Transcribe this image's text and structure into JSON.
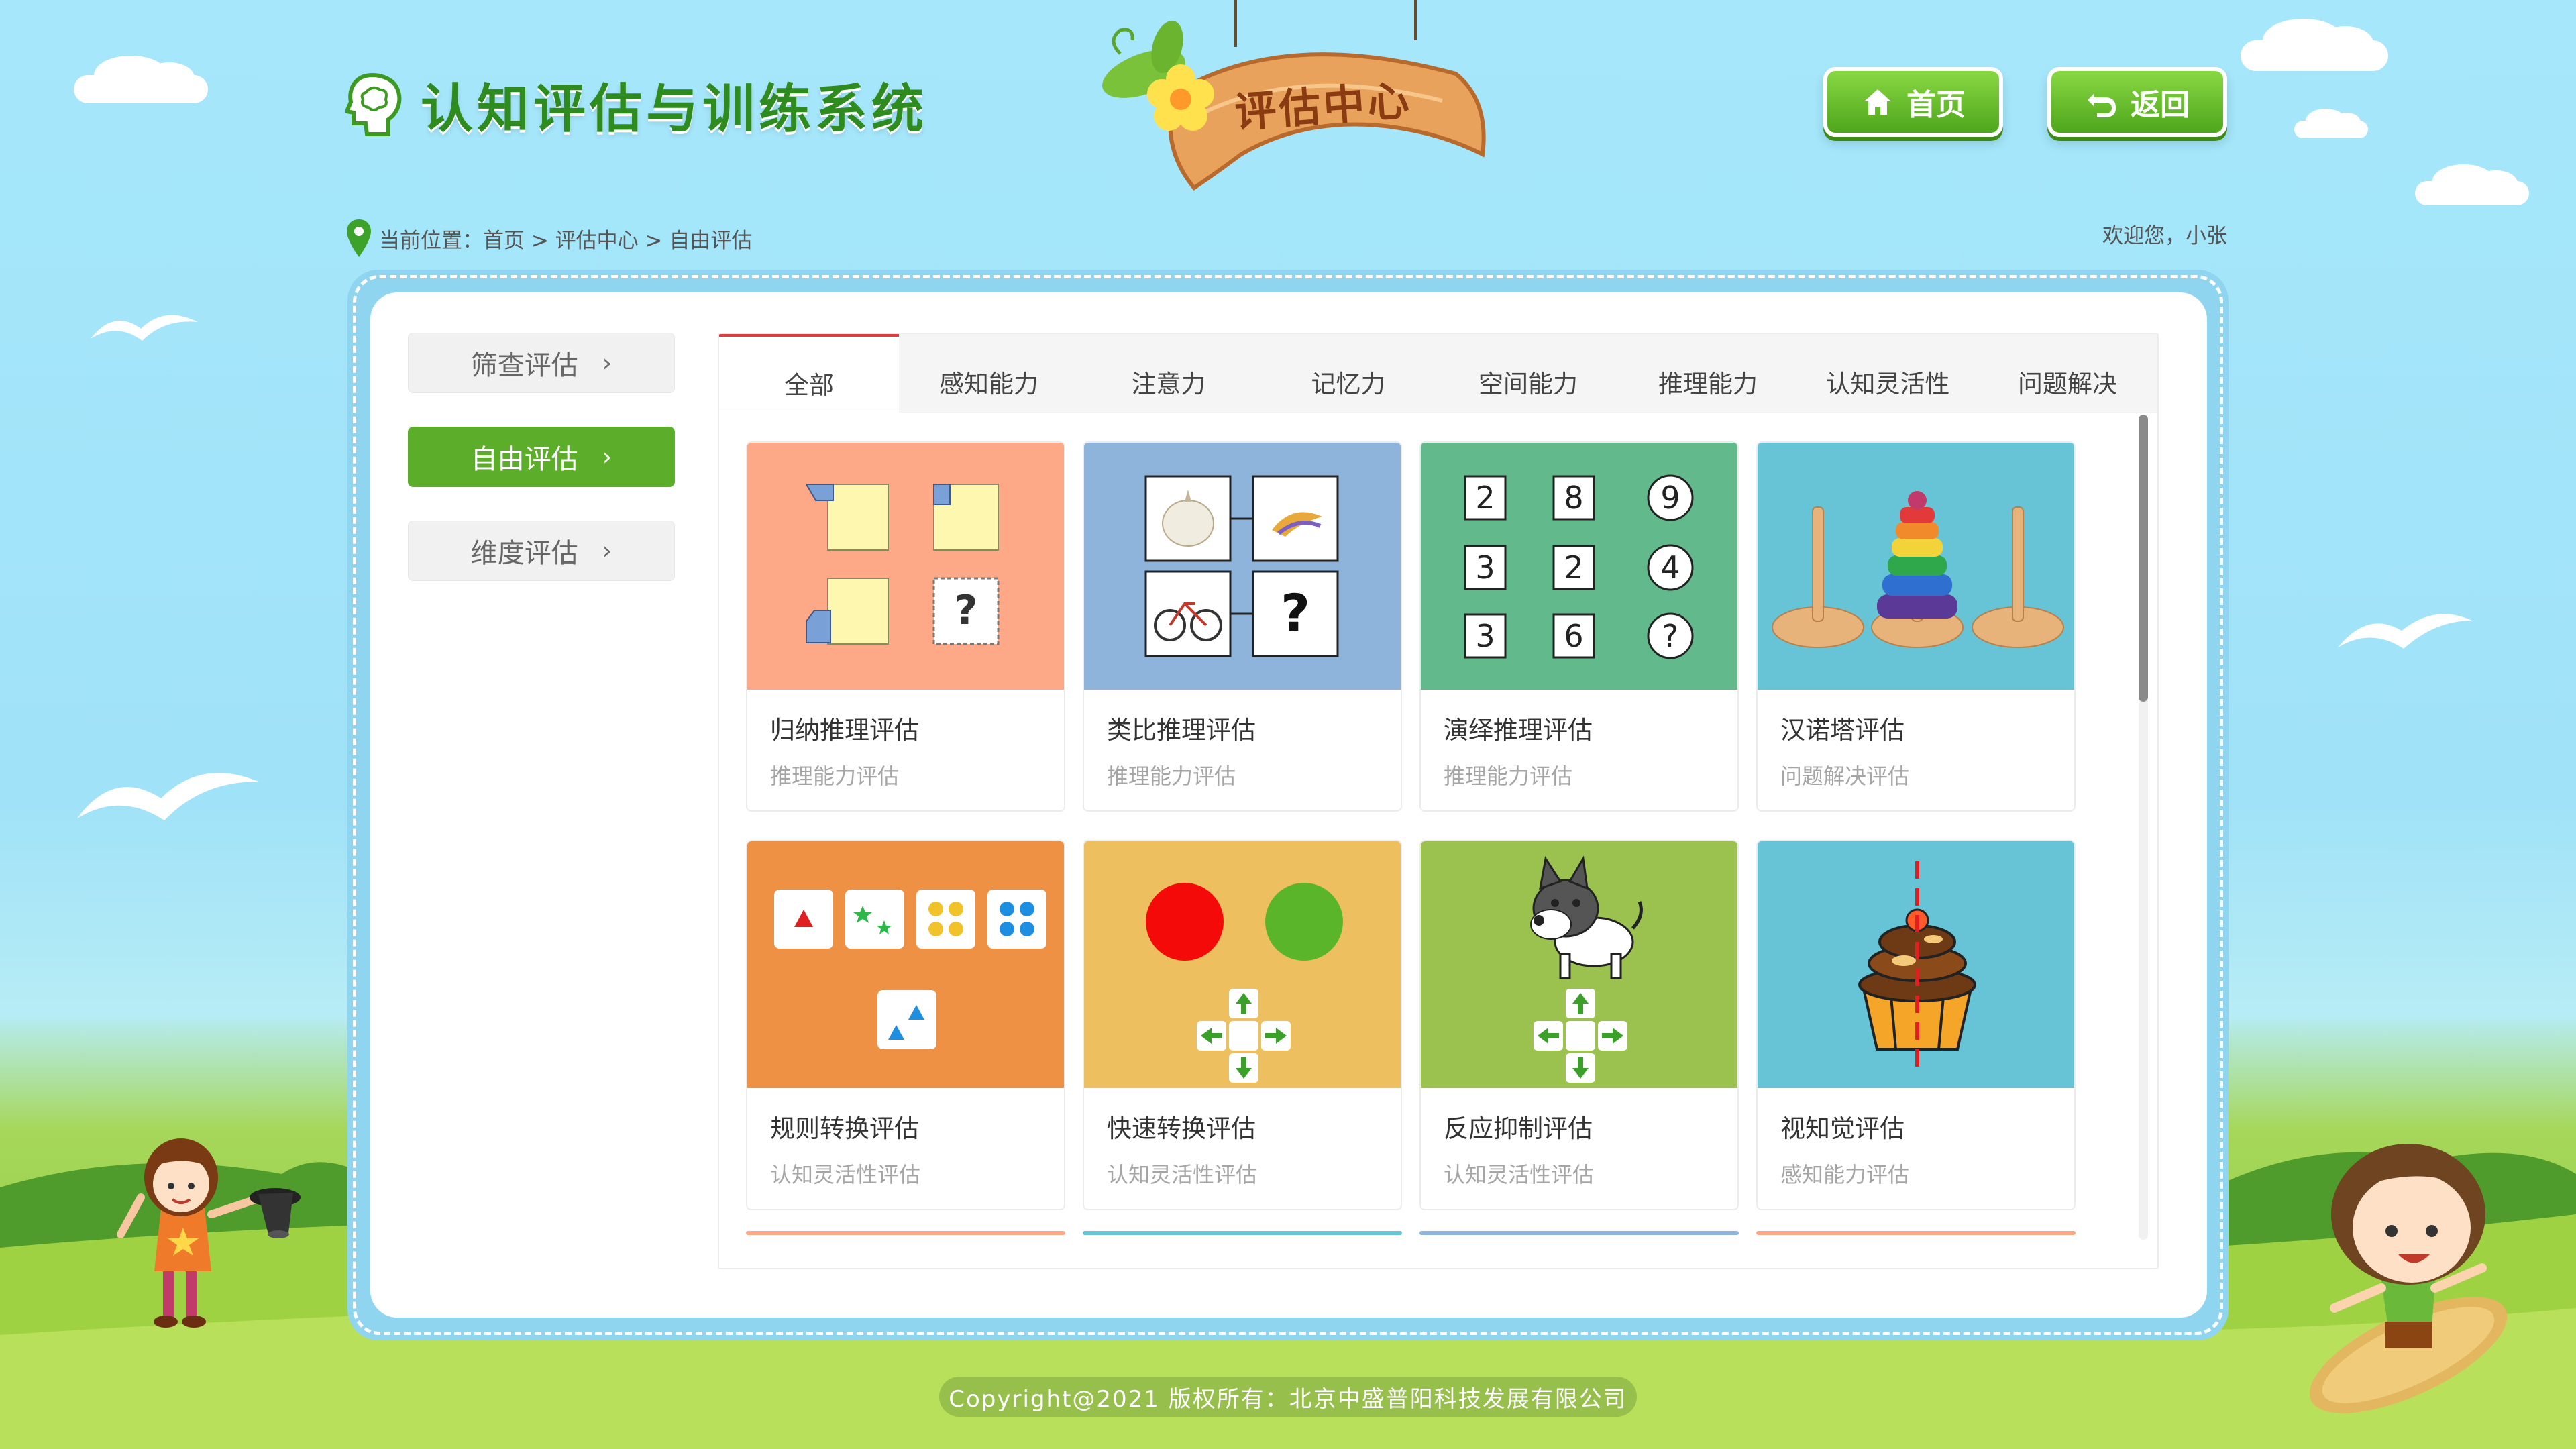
{
  "app": {
    "title": "认知评估与训练系统",
    "sign": "评估中心"
  },
  "header": {
    "home_label": "首页",
    "back_label": "返回"
  },
  "breadcrumb": {
    "text": "当前位置：首页 > 评估中心 > 自由评估",
    "welcome": "欢迎您，小张"
  },
  "sidebar": {
    "items": [
      {
        "label": "筛查评估",
        "chevron": "›"
      },
      {
        "label": "自由评估",
        "chevron": "›"
      },
      {
        "label": "维度评估",
        "chevron": "›"
      }
    ]
  },
  "tabs": [
    "全部",
    "感知能力",
    "注意力",
    "记忆力",
    "空间能力",
    "推理能力",
    "认知灵活性",
    "问题解决"
  ],
  "cards": [
    {
      "title": "归纳推理评估",
      "sub": "推理能力评估",
      "bg": "#fda887"
    },
    {
      "title": "类比推理评估",
      "sub": "推理能力评估",
      "bg": "#8fb4dc"
    },
    {
      "title": "演绎推理评估",
      "sub": "推理能力评估",
      "bg": "#62b98b"
    },
    {
      "title": "汉诺塔评估",
      "sub": "问题解决评估",
      "bg": "#67c4d6"
    },
    {
      "title": "规则转换评估",
      "sub": "认知灵活性评估",
      "bg": "#ef9145"
    },
    {
      "title": "快速转换评估",
      "sub": "认知灵活性评估",
      "bg": "#eebf5e"
    },
    {
      "title": "反应抑制评估",
      "sub": "认知灵活性评估",
      "bg": "#9bc24e"
    },
    {
      "title": "视知觉评估",
      "sub": "感知能力评估",
      "bg": "#67c4d6"
    }
  ],
  "deduction_numbers": {
    "col1": [
      "2",
      "3",
      "3"
    ],
    "col2": [
      "8",
      "2",
      "6"
    ],
    "col3": [
      "9",
      "4",
      "?"
    ]
  },
  "question_mark": "?",
  "footer": {
    "copyright": "Copyright@2021 版权所有：北京中盛普阳科技发展有限公司"
  },
  "colors": {
    "brand_green": "#5cae2a",
    "active_tab_line": "#e23c3c",
    "frame_blue": "#8fd5ef"
  }
}
